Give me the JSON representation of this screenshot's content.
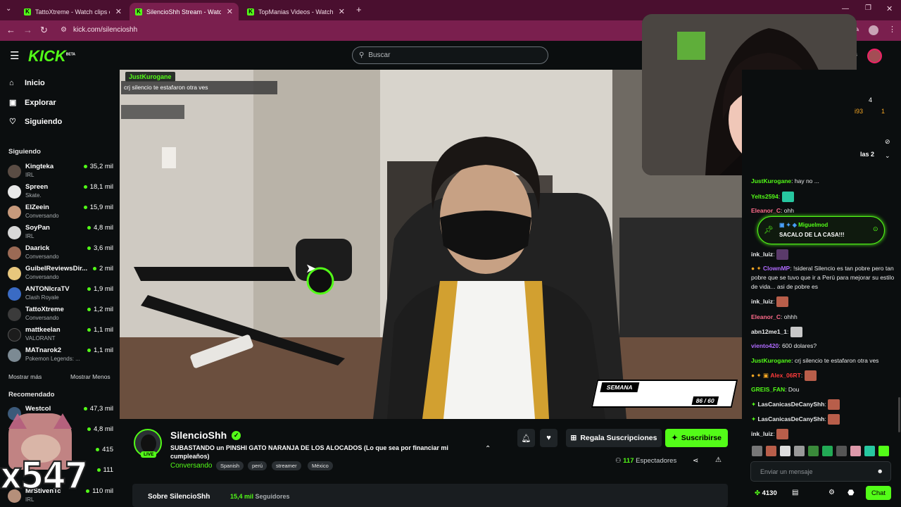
{
  "browser": {
    "tabs": [
      {
        "title": "TattoXtreme - Watch clips on Ki"
      },
      {
        "title": "SilencioShh Stream - Watch Live"
      },
      {
        "title": "TopManias Videos - Watch On"
      }
    ],
    "new_tab": "+",
    "url": "kick.com/silencioshh"
  },
  "header": {
    "logo": "KICK",
    "logo_badge": "BETA",
    "search_placeholder": "Buscar"
  },
  "sidebar": {
    "nav": [
      {
        "label": "Inicio",
        "icon": "home-icon"
      },
      {
        "label": "Explorar",
        "icon": "compass-icon"
      },
      {
        "label": "Siguiendo",
        "icon": "heart-icon"
      }
    ],
    "following_title": "Siguiendo",
    "following": [
      {
        "name": "Kingteka",
        "category": "IRL",
        "viewers": "35,2 mil"
      },
      {
        "name": "Spreen",
        "category": "Skate.",
        "viewers": "18,1 mil"
      },
      {
        "name": "ElZeein",
        "category": "Conversando",
        "viewers": "15,9 mil"
      },
      {
        "name": "SoyPan",
        "category": "IRL",
        "viewers": "4,8 mil"
      },
      {
        "name": "Daarick",
        "category": "Conversando",
        "viewers": "3,6 mil"
      },
      {
        "name": "GuibelReviewsDir...",
        "category": "Conversando",
        "viewers": "2 mil"
      },
      {
        "name": "ANTONIcraTV",
        "category": "Clash Royale",
        "viewers": "1,9 mil"
      },
      {
        "name": "TattoXtreme",
        "category": "Conversando",
        "viewers": "1,2 mil"
      },
      {
        "name": "mattkeelan",
        "category": "VALORANT",
        "viewers": "1,1 mil"
      },
      {
        "name": "MATnarok2",
        "category": "Pokemon Legends: ...",
        "viewers": "1,1 mil"
      }
    ],
    "show_more": "Mostrar más",
    "show_less": "Mostrar Menos",
    "recommended_title": "Recomendado",
    "recommended": [
      {
        "name": "Westcol",
        "category": "",
        "viewers": "47,3 mil"
      },
      {
        "name": "",
        "category": "",
        "viewers": "4,8 mil"
      },
      {
        "name": "",
        "category": "",
        "viewers": "415"
      },
      {
        "name": "",
        "category": "",
        "viewers": "111"
      },
      {
        "name": "MrStivenTc",
        "category": "IRL",
        "viewers": "110 mil"
      }
    ],
    "overlay_text": "x547"
  },
  "video": {
    "overlay_user": "JustKurogane",
    "overlay_msg": "crj silencio te estafaron otra ves",
    "semana_label": "SEMANA",
    "semana_count": "86 / 60"
  },
  "stream": {
    "streamer": "SilencioShh",
    "live": "LIVE",
    "title": "SUBASTANDO un PINSHI GATO NARANJA DE LOS ALOCADOS (Lo que sea por financiar mi cumpleaños)",
    "category": "Conversando",
    "tags": [
      "Spanish",
      "perú",
      "streamer",
      "México"
    ],
    "gift_label": "Regala Suscripciones",
    "subscribe_label": "Suscribirse",
    "viewer_count": "117",
    "viewer_label": "Espectadores",
    "about_title": "Sobre SilencioShh",
    "followers_count": "15,4 mil",
    "followers_label": "Seguidores"
  },
  "chat": {
    "top_fragments": [
      "4",
      "i93",
      "1",
      "las 2"
    ],
    "messages": [
      {
        "user": "JustKurogane",
        "color": "#53fc18",
        "text": "hay no ..."
      },
      {
        "user": "Yelts2594",
        "color": "#53fc18",
        "text": ""
      },
      {
        "user": "Eleanor_C",
        "color": "#ff6b8b",
        "text": "ohh"
      },
      {
        "user": "ink_luiz",
        "color": "#e9eaeb",
        "text": ""
      },
      {
        "user": "ClownMP",
        "color": "#b06bff",
        "text": "!sideral Silencio es tan pobre pero tan pobre que se tuvo que ir a Perú para mejorar su estilo de vida... asi de pobre es"
      },
      {
        "user": "ink_luiz",
        "color": "#e9eaeb",
        "text": ""
      },
      {
        "user": "Eleanor_C",
        "color": "#ff6b8b",
        "text": "ohhh"
      },
      {
        "user": "abn12me1_1",
        "color": "#e9eaeb",
        "text": ""
      },
      {
        "user": "viento420",
        "color": "#b06bff",
        "text": "600 dolares?"
      },
      {
        "user": "JustKurogane",
        "color": "#53fc18",
        "text": "crj silencio te estafaron otra ves"
      },
      {
        "user": "Alex_06RT",
        "color": "#ff3b3b",
        "text": ""
      },
      {
        "user": "GREIS_FAN",
        "color": "#53fc18",
        "text": "Dou"
      },
      {
        "user": "LasCanicasDeCanyShh",
        "color": "#e9eaeb",
        "text": ""
      },
      {
        "user": "LasCanicasDeCanyShh",
        "color": "#e9eaeb",
        "text": ""
      },
      {
        "user": "ink_luiz",
        "color": "#e9eaeb",
        "text": ""
      }
    ],
    "pinned_user": "Miguelmod",
    "pinned_text": "SACALO DE LA CASA!!!",
    "input_placeholder": "Enviar un mensaje",
    "points": "4130",
    "chat_button": "Chat"
  },
  "colors": {
    "accent": "#53fc18",
    "browser": "#7a1f4e"
  }
}
